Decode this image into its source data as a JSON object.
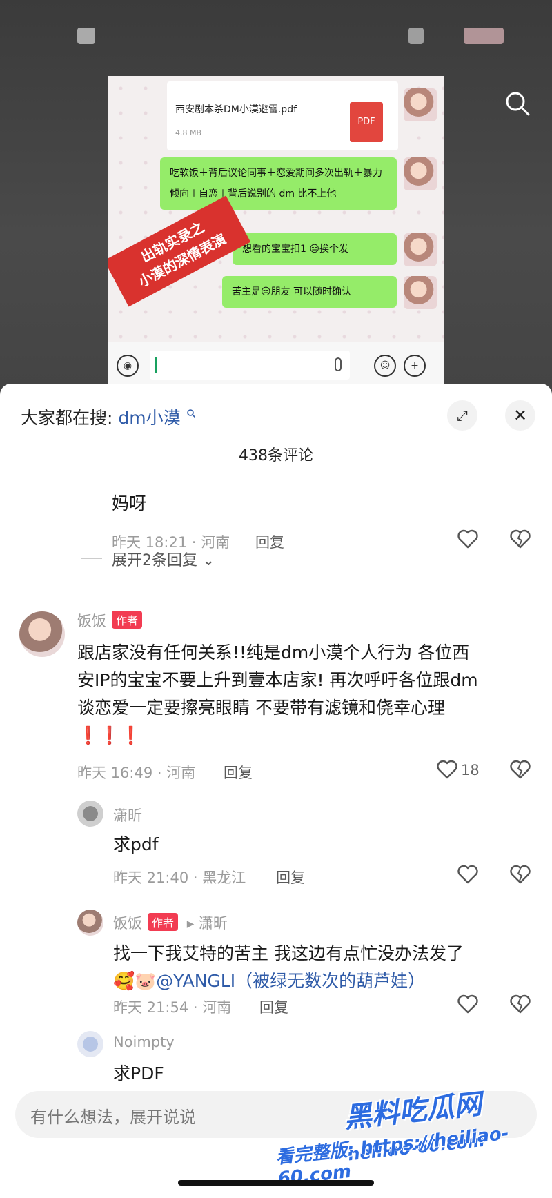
{
  "video": {
    "file_name": "西安剧本杀DM小漠避雷.pdf",
    "file_size": "4.8 MB",
    "file_icon_label": "PDF",
    "stamp": [
      "出轨实录之",
      "小漠的深情表演"
    ],
    "messages": [
      "吃软饭＋背后议论同事＋恋爱期间多次出轨＋暴力倾向＋自恋＋背后说别的 dm 比不上他",
      "想看的宝宝扣1 😑挨个发",
      "苦主是😑朋友  可以随时确认"
    ]
  },
  "header": {
    "hot_search_prefix": "大家都在搜:",
    "hot_search_keyword": "dm小漠",
    "comment_count": "438条评论"
  },
  "comments": [
    {
      "text": "妈呀",
      "time": "昨天 18:21 · 河南",
      "reply_label": "回复",
      "expand_label": "展开2条回复"
    },
    {
      "name": "饭饭",
      "badge": "作者",
      "text": [
        "跟店家没有任何关系!!纯是dm小漠个人行为 各位西",
        "安IP的宝宝不要上升到壹本店家! 再次呼吁各位跟dm",
        "谈恋爱一定要擦亮眼睛 不要带有滤镜和侥幸心理",
        "❗❗❗"
      ],
      "time": "昨天 16:49 · 河南",
      "reply_label": "回复",
      "likes": "18"
    },
    {
      "name": "潇昕",
      "text": "求pdf",
      "time": "昨天 21:40 · 黑龙江",
      "reply_label": "回复"
    },
    {
      "name": "饭饭",
      "badge": "作者",
      "reply_to": "▸ 潇昕",
      "text": "找一下我艾特的苦主 我这边有点忙没办法发了",
      "emoji": "🥰🐷",
      "mention": "@YANGLI（被绿无数次的葫芦娃）",
      "time": "昨天 21:54 · 河南",
      "reply_label": "回复"
    },
    {
      "name": "Noimpty",
      "text": "求PDF"
    }
  ],
  "input": {
    "placeholder": "有什么想法，展开说说"
  },
  "watermark": {
    "line1": "黑料吃瓜网",
    "line2": "heiliao-60.com",
    "line3": "看完整版: https://heiliao-60.com"
  }
}
